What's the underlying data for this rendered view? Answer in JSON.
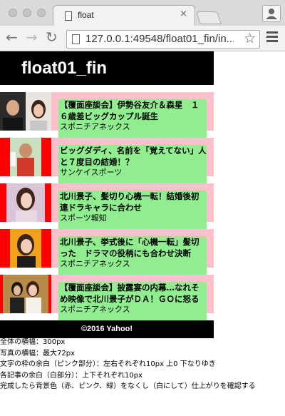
{
  "browser": {
    "tab_title": "float",
    "tab_close": "×",
    "url": "127.0.0.1:49548/float01_fin/in..."
  },
  "page": {
    "header_title": "float01_fin",
    "articles": [
      {
        "title": "【覆面座談会】伊勢谷友介＆森星　１６歳差ビッグカップル誕生",
        "source": "スポニチアネックス"
      },
      {
        "title": "ビッグダディ、名前を「覚えてない」人と７度目の結婚！？",
        "source": "サンケイスポーツ"
      },
      {
        "title": "北川景子、髪切り心機一転！結婚後初連ドラキャラに合わせ",
        "source": "スポーツ報知"
      },
      {
        "title": "北川景子、挙式後に「心機一転」髪切った　ドラマの役柄にも合わせ決断",
        "source": "スポニチアネックス"
      },
      {
        "title": "【覆面座談会】披露宴の内幕…なれそめ映像で北川景子がＤＡ！ＧＯに怒る",
        "source": "スポニチアネックス"
      }
    ],
    "footer": "©2016 Yahoo!",
    "notes": [
      "全体の横幅：300px",
      "写真の横幅：最大72px",
      "文字の枠の余白（ピンク部分）：左右それぞれ10px 上0 下なりゆき",
      "各記事の余白（白部分）：上下それぞれ10px",
      "完成したら背景色（赤、ピンク、緑）をなくし（白にして）仕上がりを確認する"
    ]
  },
  "colors": {
    "article_bg": "#ffc0cb",
    "text_bg": "#90ee90",
    "photo_bg": "#ff0000",
    "header_bg": "#000000"
  }
}
